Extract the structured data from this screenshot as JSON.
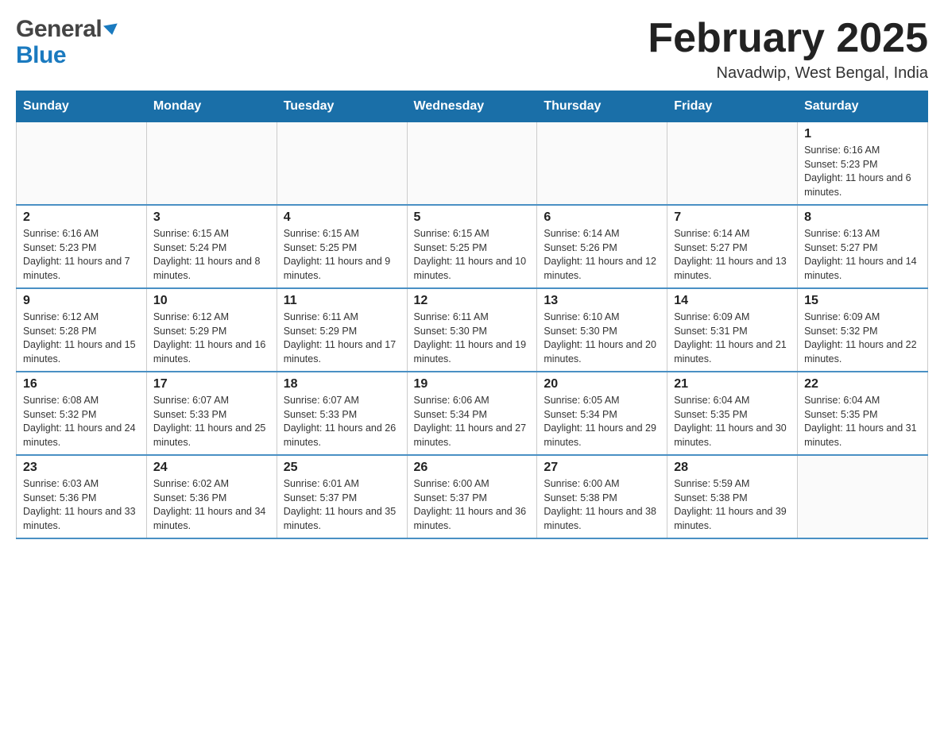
{
  "header": {
    "logo_general": "General",
    "logo_blue": "Blue",
    "month_title": "February 2025",
    "location": "Navadwip, West Bengal, India"
  },
  "weekdays": [
    "Sunday",
    "Monday",
    "Tuesday",
    "Wednesday",
    "Thursday",
    "Friday",
    "Saturday"
  ],
  "weeks": [
    {
      "days": [
        {
          "number": "",
          "info": ""
        },
        {
          "number": "",
          "info": ""
        },
        {
          "number": "",
          "info": ""
        },
        {
          "number": "",
          "info": ""
        },
        {
          "number": "",
          "info": ""
        },
        {
          "number": "",
          "info": ""
        },
        {
          "number": "1",
          "info": "Sunrise: 6:16 AM\nSunset: 5:23 PM\nDaylight: 11 hours and 6 minutes."
        }
      ]
    },
    {
      "days": [
        {
          "number": "2",
          "info": "Sunrise: 6:16 AM\nSunset: 5:23 PM\nDaylight: 11 hours and 7 minutes."
        },
        {
          "number": "3",
          "info": "Sunrise: 6:15 AM\nSunset: 5:24 PM\nDaylight: 11 hours and 8 minutes."
        },
        {
          "number": "4",
          "info": "Sunrise: 6:15 AM\nSunset: 5:25 PM\nDaylight: 11 hours and 9 minutes."
        },
        {
          "number": "5",
          "info": "Sunrise: 6:15 AM\nSunset: 5:25 PM\nDaylight: 11 hours and 10 minutes."
        },
        {
          "number": "6",
          "info": "Sunrise: 6:14 AM\nSunset: 5:26 PM\nDaylight: 11 hours and 12 minutes."
        },
        {
          "number": "7",
          "info": "Sunrise: 6:14 AM\nSunset: 5:27 PM\nDaylight: 11 hours and 13 minutes."
        },
        {
          "number": "8",
          "info": "Sunrise: 6:13 AM\nSunset: 5:27 PM\nDaylight: 11 hours and 14 minutes."
        }
      ]
    },
    {
      "days": [
        {
          "number": "9",
          "info": "Sunrise: 6:12 AM\nSunset: 5:28 PM\nDaylight: 11 hours and 15 minutes."
        },
        {
          "number": "10",
          "info": "Sunrise: 6:12 AM\nSunset: 5:29 PM\nDaylight: 11 hours and 16 minutes."
        },
        {
          "number": "11",
          "info": "Sunrise: 6:11 AM\nSunset: 5:29 PM\nDaylight: 11 hours and 17 minutes."
        },
        {
          "number": "12",
          "info": "Sunrise: 6:11 AM\nSunset: 5:30 PM\nDaylight: 11 hours and 19 minutes."
        },
        {
          "number": "13",
          "info": "Sunrise: 6:10 AM\nSunset: 5:30 PM\nDaylight: 11 hours and 20 minutes."
        },
        {
          "number": "14",
          "info": "Sunrise: 6:09 AM\nSunset: 5:31 PM\nDaylight: 11 hours and 21 minutes."
        },
        {
          "number": "15",
          "info": "Sunrise: 6:09 AM\nSunset: 5:32 PM\nDaylight: 11 hours and 22 minutes."
        }
      ]
    },
    {
      "days": [
        {
          "number": "16",
          "info": "Sunrise: 6:08 AM\nSunset: 5:32 PM\nDaylight: 11 hours and 24 minutes."
        },
        {
          "number": "17",
          "info": "Sunrise: 6:07 AM\nSunset: 5:33 PM\nDaylight: 11 hours and 25 minutes."
        },
        {
          "number": "18",
          "info": "Sunrise: 6:07 AM\nSunset: 5:33 PM\nDaylight: 11 hours and 26 minutes."
        },
        {
          "number": "19",
          "info": "Sunrise: 6:06 AM\nSunset: 5:34 PM\nDaylight: 11 hours and 27 minutes."
        },
        {
          "number": "20",
          "info": "Sunrise: 6:05 AM\nSunset: 5:34 PM\nDaylight: 11 hours and 29 minutes."
        },
        {
          "number": "21",
          "info": "Sunrise: 6:04 AM\nSunset: 5:35 PM\nDaylight: 11 hours and 30 minutes."
        },
        {
          "number": "22",
          "info": "Sunrise: 6:04 AM\nSunset: 5:35 PM\nDaylight: 11 hours and 31 minutes."
        }
      ]
    },
    {
      "days": [
        {
          "number": "23",
          "info": "Sunrise: 6:03 AM\nSunset: 5:36 PM\nDaylight: 11 hours and 33 minutes."
        },
        {
          "number": "24",
          "info": "Sunrise: 6:02 AM\nSunset: 5:36 PM\nDaylight: 11 hours and 34 minutes."
        },
        {
          "number": "25",
          "info": "Sunrise: 6:01 AM\nSunset: 5:37 PM\nDaylight: 11 hours and 35 minutes."
        },
        {
          "number": "26",
          "info": "Sunrise: 6:00 AM\nSunset: 5:37 PM\nDaylight: 11 hours and 36 minutes."
        },
        {
          "number": "27",
          "info": "Sunrise: 6:00 AM\nSunset: 5:38 PM\nDaylight: 11 hours and 38 minutes."
        },
        {
          "number": "28",
          "info": "Sunrise: 5:59 AM\nSunset: 5:38 PM\nDaylight: 11 hours and 39 minutes."
        },
        {
          "number": "",
          "info": ""
        }
      ]
    }
  ]
}
